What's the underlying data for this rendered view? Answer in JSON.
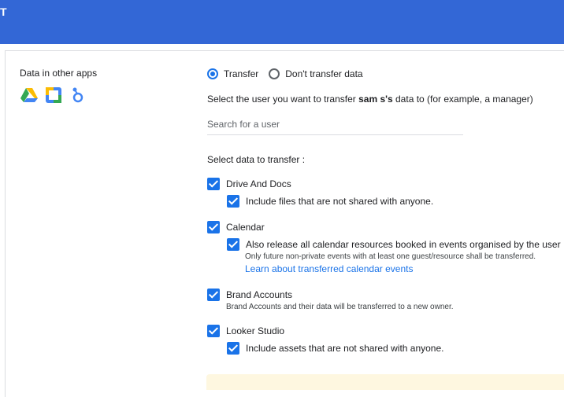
{
  "header": {
    "title": "T"
  },
  "section": {
    "label": "Data in other apps"
  },
  "icons": [
    "google-drive-icon",
    "google-calendar-icon",
    "looker-studio-icon"
  ],
  "transfer_options": {
    "transfer_label": "Transfer",
    "dont_transfer_label": "Don't transfer data",
    "selected": "Transfer"
  },
  "instruction": {
    "prefix": "Select the user you want to transfer ",
    "user": "sam s's",
    "suffix": " data to (for example, a manager)"
  },
  "search": {
    "placeholder": "Search for a user",
    "value": ""
  },
  "select_heading": "Select data to transfer :",
  "items": {
    "drive": {
      "label": "Drive And Docs",
      "checked": true
    },
    "drive_sub": {
      "label": "Include files that are not shared with anyone.",
      "checked": true
    },
    "calendar": {
      "label": "Calendar",
      "checked": true
    },
    "calendar_sub": {
      "label": "Also release all calendar resources booked in events organised by the user",
      "checked": true
    },
    "calendar_note": "Only future non-private events with at least one guest/resource shall be transferred.",
    "calendar_link": "Learn about transferred calendar events",
    "brand": {
      "label": "Brand Accounts",
      "checked": true
    },
    "brand_note": "Brand Accounts and their data will be transferred to a new owner.",
    "looker": {
      "label": "Looker Studio",
      "checked": true
    },
    "looker_sub": {
      "label": "Include assets that are not shared with anyone.",
      "checked": true
    }
  },
  "colors": {
    "header_bg": "#3367d6",
    "accent": "#1a73e8",
    "notice_bg": "#fef7e0"
  }
}
